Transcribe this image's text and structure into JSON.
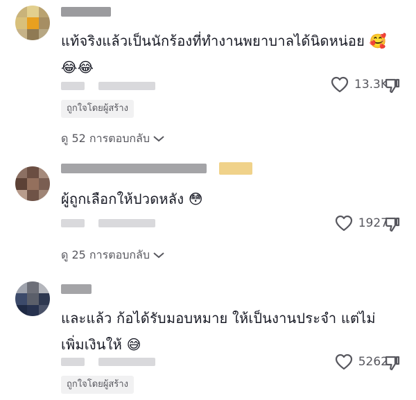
{
  "comments": [
    {
      "text": "แท้จริงแล้วเป็นนักร้องที่ทำงานพยาบาลได้นิดหน่อย",
      "emojis": "🥰😂😂",
      "likes": "13.3K",
      "badge": "ถูกใจโดยผู้สร้าง",
      "replies": "ดู 52 การตอบกลับ"
    },
    {
      "text": "ผู้ถูกเลือกให้ปวดหลัง",
      "emojis": "😳",
      "likes": "1927",
      "replies": "ดู 25 การตอบกลับ"
    },
    {
      "text": "และแล้ว ก้อได้รับมอบหมาย ให้เป็นงานประจำ แต่ไม่เพิ่มเงินให้",
      "emojis": "😅",
      "likes": "5262",
      "badge": "ถูกใจโดยผู้สร้าง"
    }
  ],
  "colors": {
    "text": "#161823",
    "secondary": "#57575e",
    "pill_bg": "#f1f1f2"
  },
  "icons": [
    "heart-icon",
    "dislike-icon",
    "chevron-down-icon"
  ]
}
